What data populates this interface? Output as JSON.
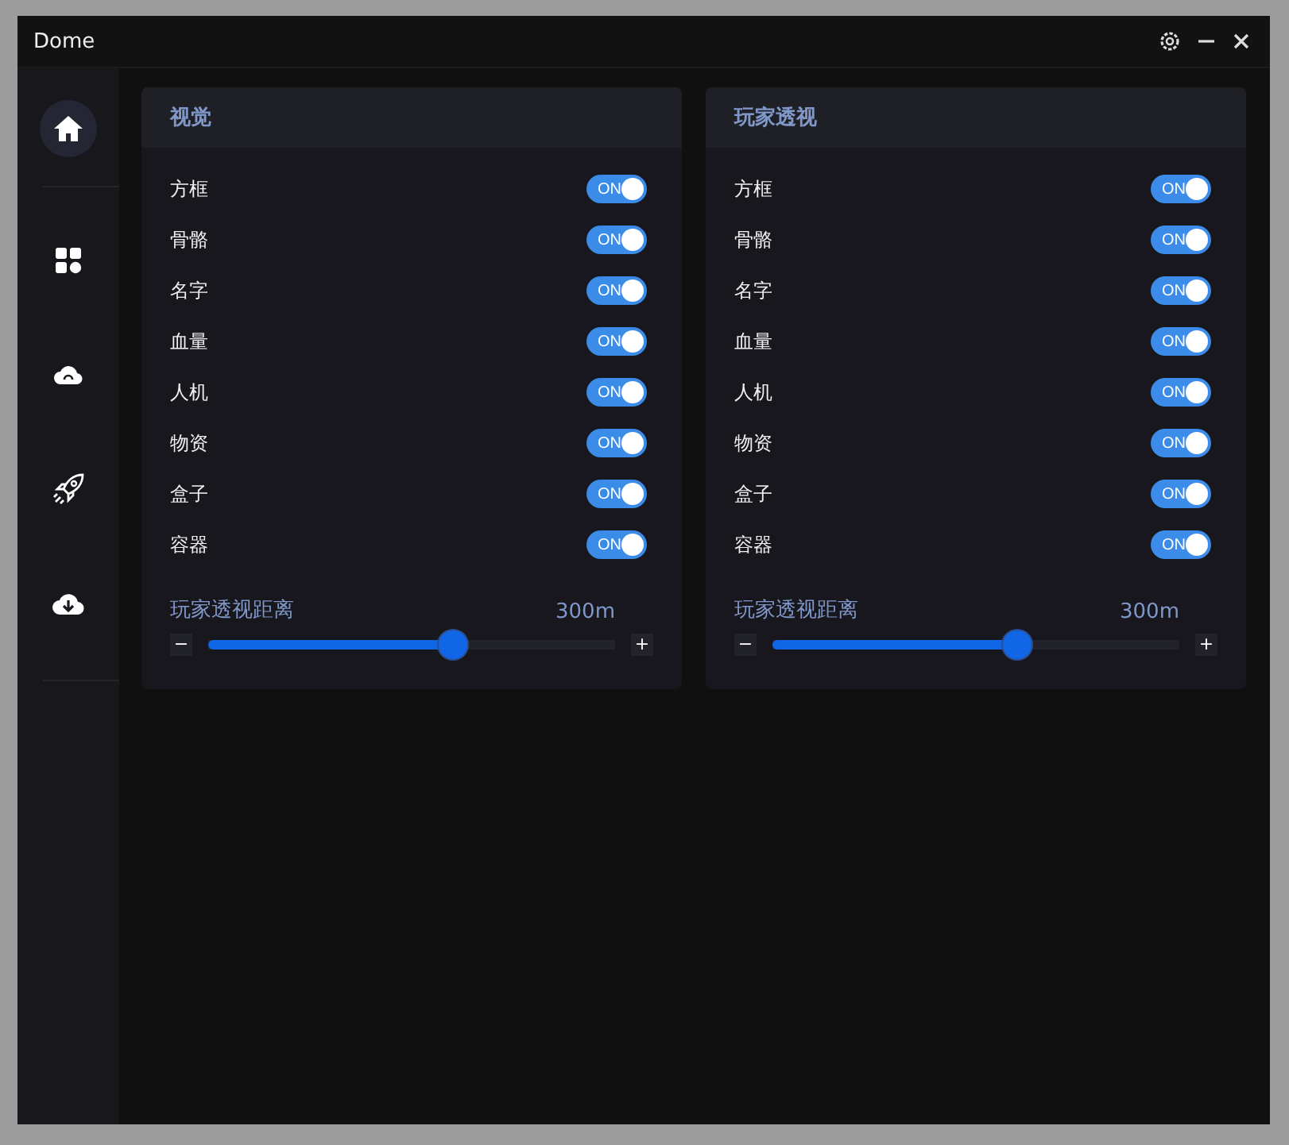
{
  "window": {
    "title": "Dome"
  },
  "sidebar": {
    "items": [
      {
        "kind": "home",
        "selected": true
      },
      {
        "kind": "grid",
        "selected": false
      },
      {
        "kind": "cloud",
        "selected": false
      },
      {
        "kind": "rocket",
        "selected": false
      },
      {
        "kind": "download",
        "selected": false
      }
    ]
  },
  "panels": [
    {
      "title": "视觉",
      "toggles": [
        {
          "label": "方框",
          "on": true,
          "state_text": "ON"
        },
        {
          "label": "骨骼",
          "on": true,
          "state_text": "ON"
        },
        {
          "label": "名字",
          "on": true,
          "state_text": "ON"
        },
        {
          "label": "血量",
          "on": true,
          "state_text": "ON"
        },
        {
          "label": "人机",
          "on": true,
          "state_text": "ON"
        },
        {
          "label": "物资",
          "on": true,
          "state_text": "ON"
        },
        {
          "label": "盒子",
          "on": true,
          "state_text": "ON"
        },
        {
          "label": "容器",
          "on": true,
          "state_text": "ON"
        }
      ],
      "slider": {
        "label": "玩家透视距离",
        "reading": "300m",
        "level": 0.6,
        "minus": "−",
        "plus": "+"
      }
    },
    {
      "title": "玩家透视",
      "toggles": [
        {
          "label": "方框",
          "on": true,
          "state_text": "ON"
        },
        {
          "label": "骨骼",
          "on": true,
          "state_text": "ON"
        },
        {
          "label": "名字",
          "on": true,
          "state_text": "ON"
        },
        {
          "label": "血量",
          "on": true,
          "state_text": "ON"
        },
        {
          "label": "人机",
          "on": true,
          "state_text": "ON"
        },
        {
          "label": "物资",
          "on": true,
          "state_text": "ON"
        },
        {
          "label": "盒子",
          "on": true,
          "state_text": "ON"
        },
        {
          "label": "容器",
          "on": true,
          "state_text": "ON"
        }
      ],
      "slider": {
        "label": "玩家透视距离",
        "reading": "300m",
        "level": 0.6,
        "minus": "−",
        "plus": "+"
      }
    }
  ]
}
